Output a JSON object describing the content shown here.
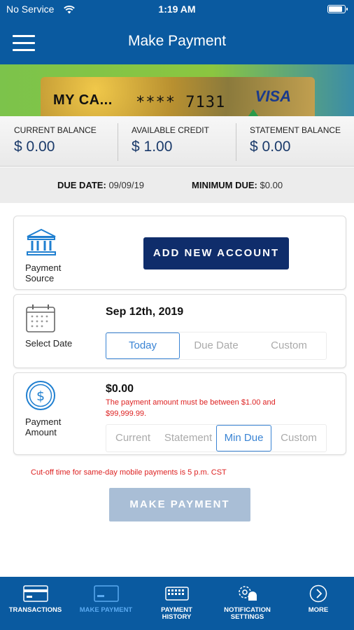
{
  "status_bar": {
    "carrier": "No Service",
    "time": "1:19 AM"
  },
  "header": {
    "title": "Make Payment"
  },
  "card": {
    "name": "MY CA...",
    "number": "**** 7131",
    "brand": "VISA"
  },
  "balances": [
    {
      "label": "CURRENT BALANCE",
      "value": "$ 0.00"
    },
    {
      "label": "AVAILABLE CREDIT",
      "value": "$ 1.00"
    },
    {
      "label": "STATEMENT BALANCE",
      "value": "$ 0.00"
    }
  ],
  "dues": {
    "due_date_label": "DUE DATE:",
    "due_date_value": "09/09/19",
    "min_due_label": "MINIMUM DUE:",
    "min_due_value": "$0.00"
  },
  "payment_source": {
    "label_line1": "Payment",
    "label_line2": "Source",
    "button": "ADD NEW ACCOUNT"
  },
  "select_date": {
    "label": "Select Date",
    "value": "Sep 12th, 2019",
    "options": [
      "Today",
      "Due Date",
      "Custom"
    ],
    "selected": "Today"
  },
  "payment_amount": {
    "label_line1": "Payment",
    "label_line2": "Amount",
    "value": "$0.00",
    "error_line1": "The payment amount must be between $1.00 and",
    "error_line2": "$99,999.99.",
    "options": [
      "Current",
      "Statement",
      "Min Due",
      "Custom"
    ],
    "selected": "Min Due"
  },
  "cutoff_note": "Cut-off time for same-day mobile payments is 5 p.m. CST",
  "make_payment_button": "MAKE PAYMENT",
  "tabs": [
    {
      "line1": "TRANSACTIONS",
      "line2": ""
    },
    {
      "line1": "MAKE PAYMENT",
      "line2": ""
    },
    {
      "line1": "PAYMENT",
      "line2": "HISTORY"
    },
    {
      "line1": "NOTIFICATION",
      "line2": "SETTINGS"
    },
    {
      "line1": "MORE",
      "line2": ""
    }
  ],
  "colors": {
    "header": "#0a5aa0",
    "button_primary": "#0f2d6b",
    "button_disabled": "#a9bed6",
    "error": "#dd2222",
    "active_tab": "#5aa9f0"
  }
}
